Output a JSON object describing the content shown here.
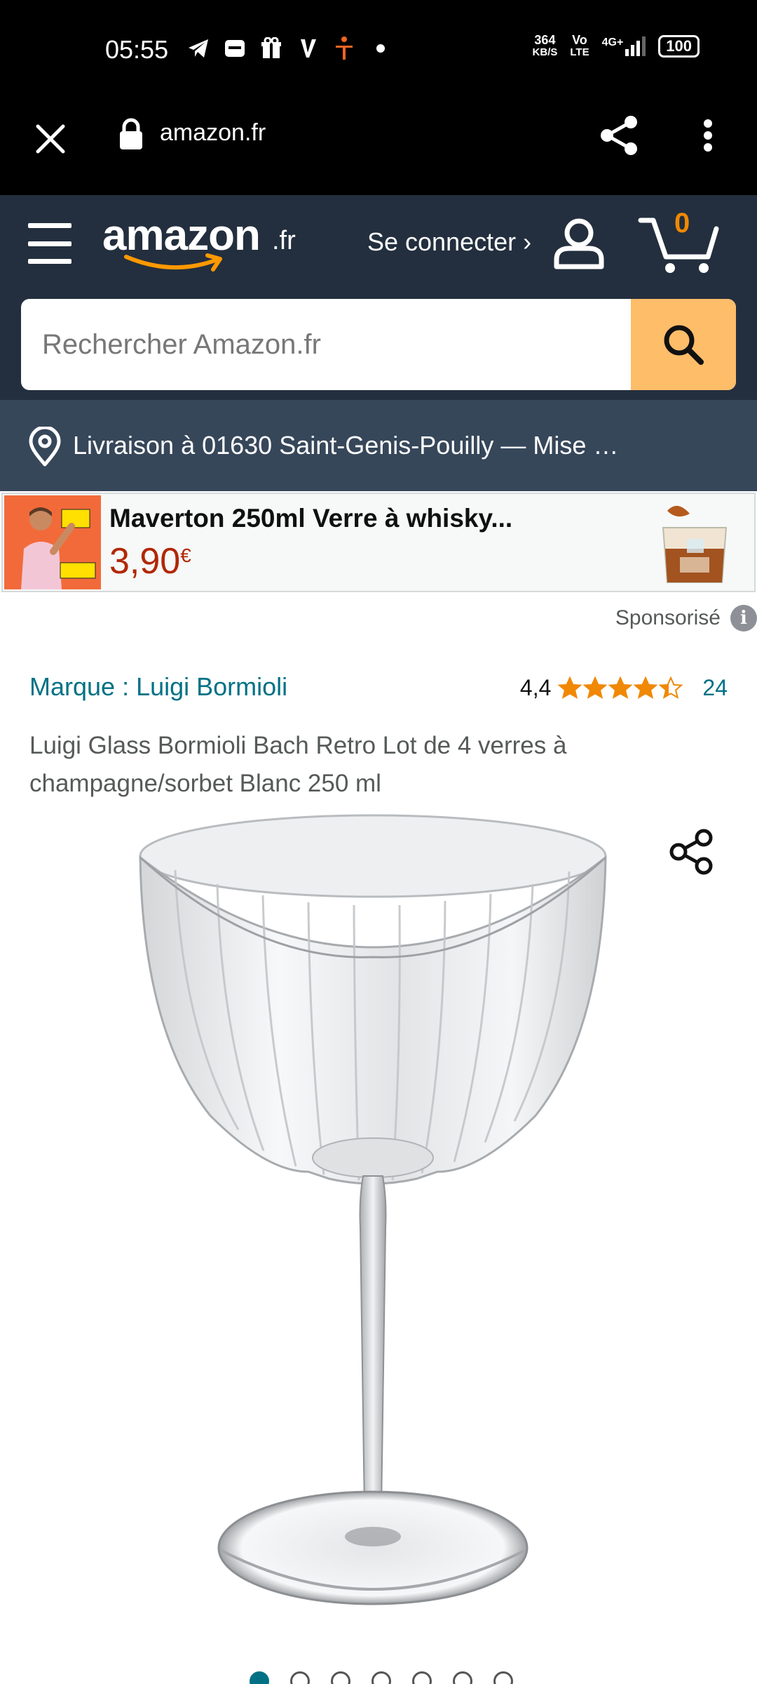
{
  "status_bar": {
    "time": "05:55",
    "net_speed_value": "364",
    "net_speed_unit": "KB/S",
    "volte_top": "Vo",
    "volte_bottom": "LTE",
    "signal": "4G+",
    "battery": "100"
  },
  "browser": {
    "url": "amazon.fr"
  },
  "header": {
    "logo": "amazon",
    "logo_tld": ".fr",
    "signin": "Se connecter ›",
    "cart_count": "0"
  },
  "search": {
    "placeholder": "Rechercher Amazon.fr"
  },
  "delivery": {
    "text": "Livraison à 01630 Saint-Genis-Pouilly — Mise …"
  },
  "sponsored_banner": {
    "title": "Maverton 250ml Verre à whisky...",
    "price": "3,90",
    "currency": "€"
  },
  "sponsored_label": "Sponsorisé",
  "product": {
    "brand": "Marque : Luigi Bormioli",
    "rating": "4,4",
    "rating_fraction": 0.88,
    "review_count": "24",
    "title": "Luigi Glass Bormioli Bach Retro Lot de 4 verres à champagne/sorbet Blanc 250 ml",
    "image_count": 7,
    "active_image": 0
  },
  "colors": {
    "header_bg": "#232f3e",
    "delivery_bg": "#37475a",
    "search_button": "#febd69",
    "link": "#007185",
    "price": "#b12704",
    "star": "#f08804"
  },
  "icons": {
    "close": "close-icon",
    "lock": "lock-icon",
    "share": "share-icon",
    "more": "more-vert-icon",
    "menu": "hamburger-icon",
    "user": "user-icon",
    "cart": "cart-icon",
    "search": "search-icon",
    "location": "location-pin-icon",
    "info": "info-icon"
  }
}
